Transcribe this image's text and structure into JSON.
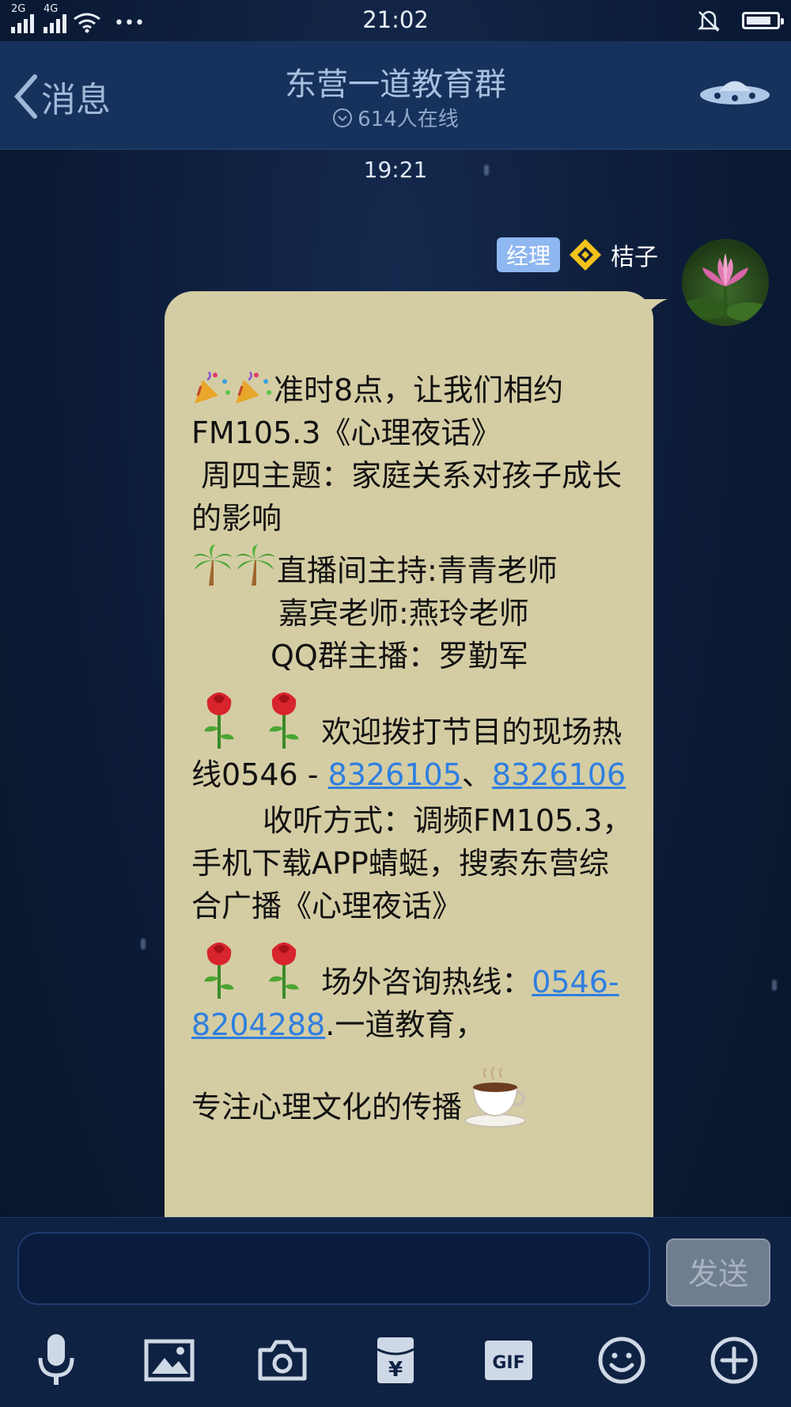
{
  "status_bar": {
    "net1": "2G",
    "net2": "4G",
    "dots": "•••",
    "time": "21:02"
  },
  "nav": {
    "back_label": "消息",
    "title": "东营一道教育群",
    "online": "614人在线"
  },
  "chat": {
    "timestamp": "19:21",
    "sender": {
      "role": "经理",
      "name": "桔子"
    },
    "message": {
      "l1": "准时8点，让我们相约FM105.3《心理夜话》",
      "l2": " 周四主题：家庭关系对孩子成长的影响",
      "host": "直播间主持:青青老师",
      "guest": "嘉宾老师:燕玲老师",
      "anchor": "QQ群主播：罗勤军",
      "hotline_text": "欢迎拨打节目的现场热线0546 - ",
      "phone1": "8326105",
      "sep": "、",
      "phone2": "8326106",
      "listen": "收听方式：调频FM105.3，手机下载APP蜻蜓，搜索东营综合广播《心理夜话》",
      "consult": "场外咨询热线：",
      "phone3": "0546-8204288",
      "tagline_a": ".一道教育，",
      "tagline_b": "专注心理文化的传播"
    }
  },
  "input": {
    "send_label": "发送"
  },
  "toolbar": {
    "gif_label": "GIF",
    "yen_label": "¥"
  },
  "colors": {
    "bubble": "#d4cda4",
    "link": "#2f7fe0",
    "header": "#16325c"
  }
}
